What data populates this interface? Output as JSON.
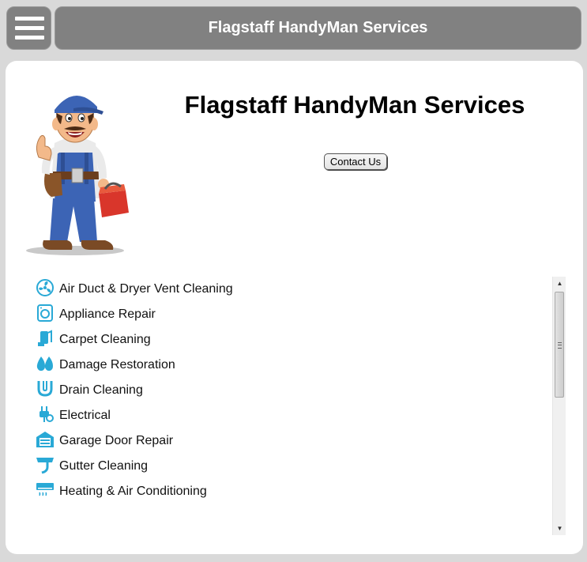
{
  "header": {
    "menu_icon": "hamburger-icon",
    "title": "Flagstaff HandyMan Services"
  },
  "main": {
    "heading": "Flagstaff HandyMan Services",
    "contact_button": "Contact Us",
    "mascot": "handyman-mascot"
  },
  "services": [
    {
      "label": "Air Duct & Dryer Vent Cleaning",
      "icon": "fan-icon"
    },
    {
      "label": "Appliance Repair",
      "icon": "washing-machine-icon"
    },
    {
      "label": "Carpet Cleaning",
      "icon": "carpet-cleaner-icon"
    },
    {
      "label": "Damage Restoration",
      "icon": "water-fire-icon"
    },
    {
      "label": "Drain Cleaning",
      "icon": "drain-pipe-icon"
    },
    {
      "label": "Electrical",
      "icon": "plug-icon"
    },
    {
      "label": "Garage Door Repair",
      "icon": "garage-icon"
    },
    {
      "label": "Gutter Cleaning",
      "icon": "gutter-icon"
    },
    {
      "label": "Heating & Air Conditioning",
      "icon": "air-conditioner-icon"
    }
  ],
  "colors": {
    "header_bg": "#818181",
    "page_bg": "#d9d9d9",
    "icon_blue": "#29a9d6"
  }
}
